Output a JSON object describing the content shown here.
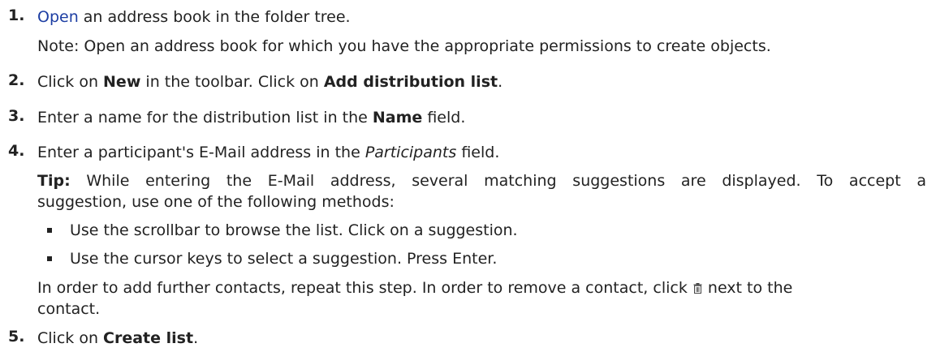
{
  "steps": [
    {
      "number": "1.",
      "link_text": "Open",
      "text_after_link": " an address book in the folder tree.",
      "note": "Note:  Open an address book for which you have the appropriate permissions to create objects."
    },
    {
      "number": "2.",
      "text_a": "Click on ",
      "bold_a": "New",
      "text_b": " in the toolbar. Click on ",
      "bold_b": "Add distribution list",
      "text_c": "."
    },
    {
      "number": "3.",
      "text_a": "Enter a name for the distribution list in the ",
      "bold_a": "Name",
      "text_b": " field."
    },
    {
      "number": "4.",
      "text_a": "Enter a participant's E-Mail address in the ",
      "italic_a": "Participants",
      "text_b": " field.",
      "tip_label": "Tip:",
      "tip_line1": " While entering the E-Mail address, several matching suggestions are displayed. To accept a",
      "tip_line2": "suggestion, use one of the following methods:",
      "bullets": [
        "Use the scrollbar to browse the list. Click on a suggestion.",
        "Use the cursor keys to select a suggestion. Press Enter."
      ],
      "further_a": "In order to add further contacts, repeat this step. In order to remove a contact, click ",
      "further_b": " next to the",
      "further_line2": "contact.",
      "trash_icon": "trash-icon"
    },
    {
      "number": "5.",
      "text_a": "Click on ",
      "bold_a": "Create list",
      "text_b": "."
    }
  ]
}
